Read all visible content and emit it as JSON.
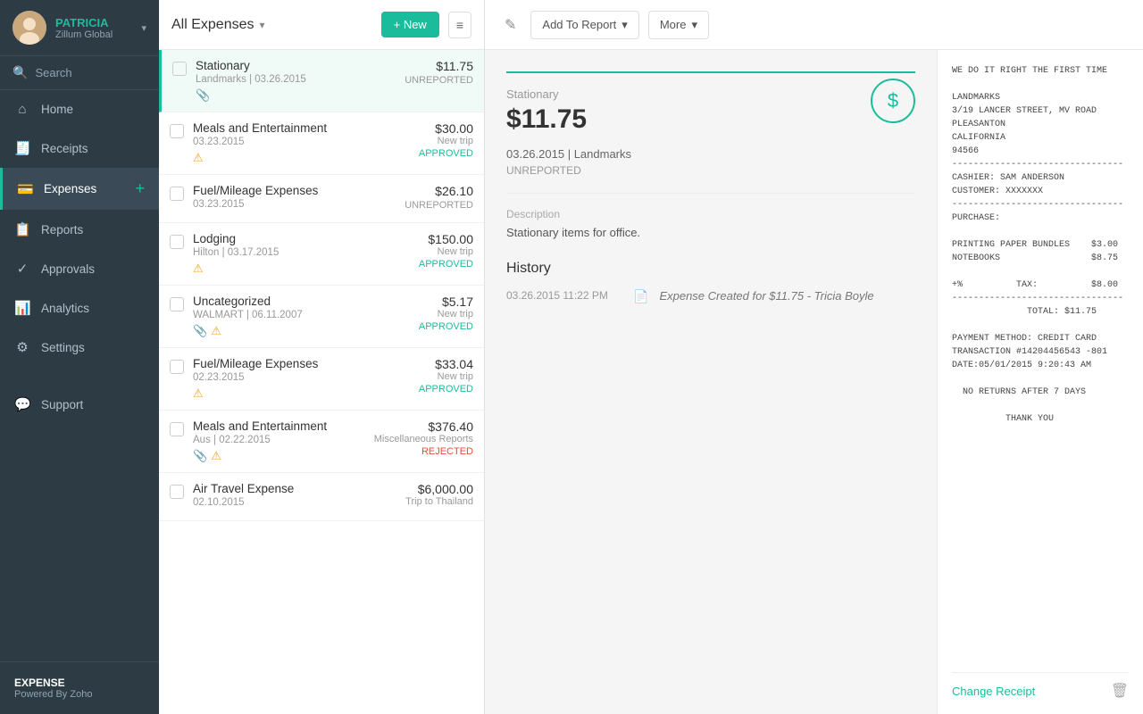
{
  "user": {
    "name": "PATRICIA",
    "company": "Zillum Global",
    "chevron": "▾"
  },
  "search": {
    "placeholder": "Search"
  },
  "sidebar": {
    "items": [
      {
        "id": "home",
        "icon": "⌂",
        "label": "Home",
        "active": false
      },
      {
        "id": "receipts",
        "icon": "◻",
        "label": "Receipts",
        "active": false
      },
      {
        "id": "expenses",
        "icon": "◎",
        "label": "Expenses",
        "active": true,
        "add": "+"
      },
      {
        "id": "reports",
        "icon": "◎",
        "label": "Reports",
        "active": false
      },
      {
        "id": "approvals",
        "icon": "◎",
        "label": "Approvals",
        "active": false
      },
      {
        "id": "analytics",
        "icon": "✦",
        "label": "Analytics",
        "active": false
      },
      {
        "id": "settings",
        "icon": "✦",
        "label": "Settings",
        "active": false
      }
    ],
    "support": {
      "id": "support",
      "icon": "◻",
      "label": "Support"
    },
    "bottom": {
      "expense_label": "EXPENSE",
      "powered_by": "Powered By Zoho"
    }
  },
  "expense_list": {
    "title": "All Expenses",
    "new_button": "+ New",
    "expenses": [
      {
        "id": 1,
        "name": "Stationary",
        "vendor": "Landmarks",
        "date": "03.26.2015",
        "amount": "$11.75",
        "status": "UNREPORTED",
        "status_class": "badge-unreported",
        "trip": "",
        "has_attachment": true,
        "has_warning": false,
        "selected": true
      },
      {
        "id": 2,
        "name": "Meals and Entertainment",
        "vendor": "",
        "date": "03.23.2015",
        "amount": "$30.00",
        "status": "APPROVED",
        "status_class": "badge-approved",
        "trip": "New trip",
        "has_attachment": false,
        "has_warning": true,
        "selected": false
      },
      {
        "id": 3,
        "name": "Fuel/Mileage Expenses",
        "vendor": "",
        "date": "03.23.2015",
        "amount": "$26.10",
        "status": "UNREPORTED",
        "status_class": "badge-unreported",
        "trip": "",
        "has_attachment": false,
        "has_warning": false,
        "selected": false
      },
      {
        "id": 4,
        "name": "Lodging",
        "vendor": "Hilton",
        "date": "03.17.2015",
        "amount": "$150.00",
        "status": "APPROVED",
        "status_class": "badge-approved",
        "trip": "New trip",
        "has_attachment": false,
        "has_warning": true,
        "selected": false
      },
      {
        "id": 5,
        "name": "Uncategorized",
        "vendor": "WALMART",
        "date": "06.11.2007",
        "amount": "$5.17",
        "status": "APPROVED",
        "status_class": "badge-approved",
        "trip": "New trip",
        "has_attachment": true,
        "has_warning": true,
        "selected": false
      },
      {
        "id": 6,
        "name": "Fuel/Mileage Expenses",
        "vendor": "",
        "date": "02.23.2015",
        "amount": "$33.04",
        "status": "APPROVED",
        "status_class": "badge-approved",
        "trip": "New trip",
        "has_attachment": false,
        "has_warning": true,
        "selected": false
      },
      {
        "id": 7,
        "name": "Meals and Entertainment",
        "vendor": "Aus",
        "date": "02.22.2015",
        "amount": "$376.40",
        "status": "REJECTED",
        "status_class": "badge-rejected",
        "trip": "Miscellaneous Reports",
        "has_attachment": true,
        "has_warning": true,
        "selected": false
      },
      {
        "id": 8,
        "name": "Air Travel Expense",
        "vendor": "",
        "date": "02.10.2015",
        "amount": "$6,000.00",
        "status": "",
        "status_class": "",
        "trip": "Trip to Thailand",
        "has_attachment": false,
        "has_warning": false,
        "selected": false
      }
    ]
  },
  "toolbar": {
    "edit_icon": "✎",
    "add_to_report_label": "Add To Report",
    "more_label": "More",
    "dropdown_arrow": "▾"
  },
  "detail": {
    "header_line_color": "#1abc9c",
    "category": "Stationary",
    "amount": "$11.75",
    "dollar_symbol": "$",
    "date": "03.26.2015",
    "vendor": "Landmarks",
    "status": "UNREPORTED",
    "description_label": "Description",
    "description": "Stationary items for office.",
    "history_title": "History",
    "history": [
      {
        "time": "03.26.2015 11:22 PM",
        "description": "Expense Created for $11.75",
        "user": "- Tricia Boyle"
      }
    ]
  },
  "receipt": {
    "text": "WE DO IT RIGHT THE FIRST TIME\n\nLANDMARKS\n3/19 LANCER STREET, MV ROAD\nPLEASANTON\nCALIFORNIA\n94566\n--------------------------------\nCASHIER: SAM ANDERSON\nCUSTOMER: XXXXXXX\n--------------------------------\nPURCHASE:\n\nPRINTING PAPER BUNDLES    $3.00\nNOTEBOOKS                 $8.75\n\n+%          TAX:          $8.00\n--------------------------------\n              TOTAL: $11.75\n\nPAYMENT METHOD: CREDIT CARD\nTRANSACTION #14204456543 -801\nDATE:05/01/2015 9:20:43 AM\n\n  NO RETURNS AFTER 7 DAYS\n\n          THANK YOU",
    "change_receipt_label": "Change Receipt",
    "delete_icon": "🗑"
  }
}
